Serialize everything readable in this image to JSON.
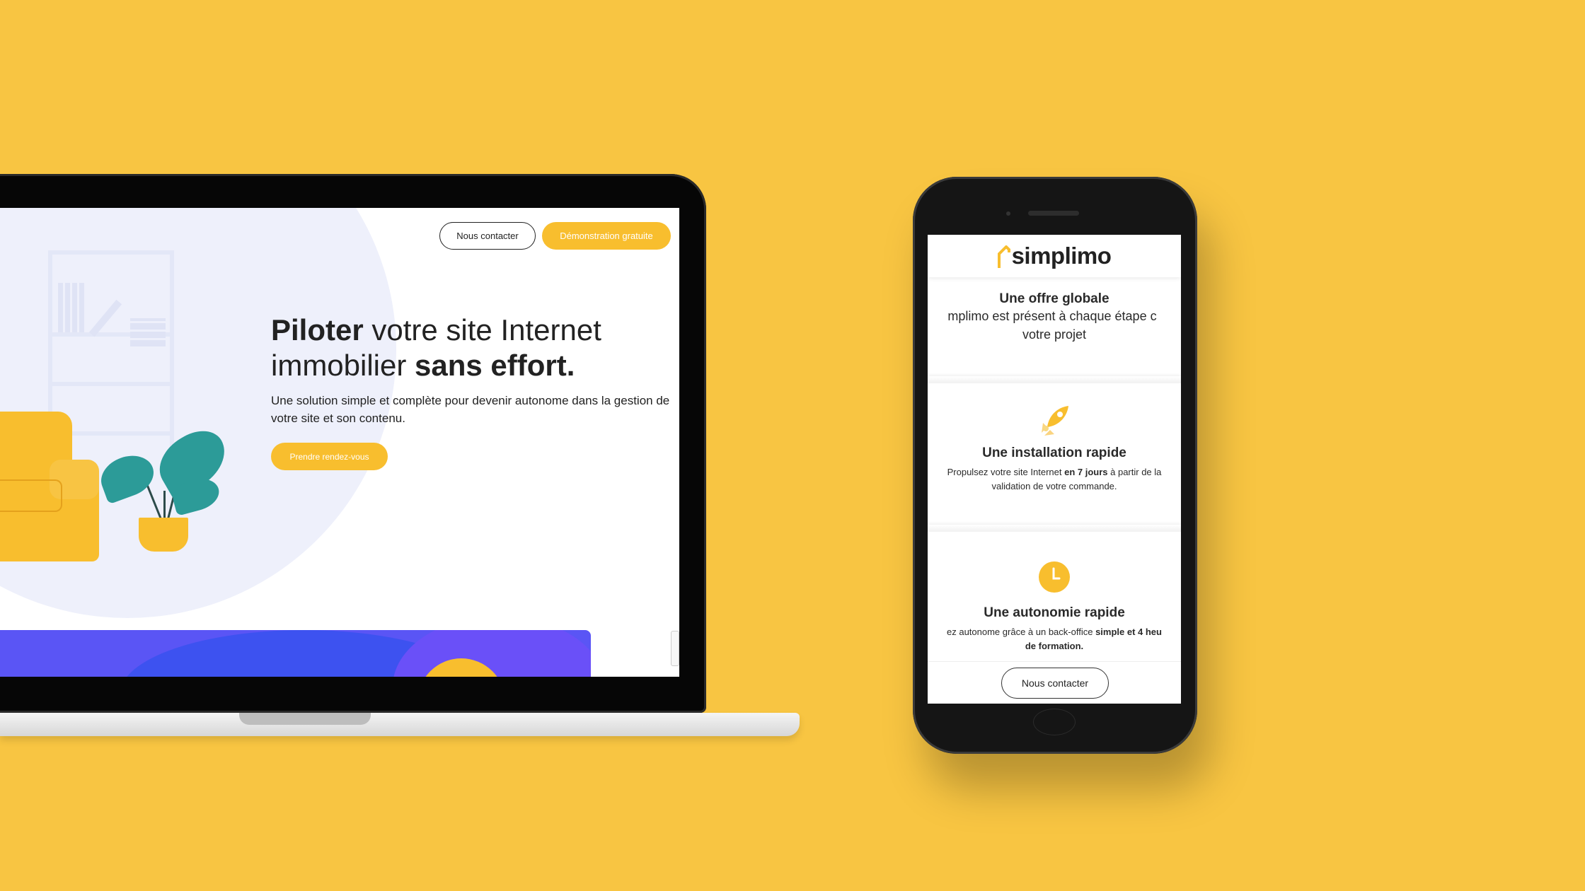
{
  "laptop": {
    "nav": {
      "contact_label": "Nous contacter",
      "demo_label": "Démonstration gratuite"
    },
    "hero": {
      "title_bold_1": "Piloter",
      "title_regular_1": " votre site Internet",
      "title_regular_2": "immobilier ",
      "title_bold_2": "sans effort.",
      "subtitle": "Une solution simple et complète pour devenir autonome dans la gestion de votre site et son contenu.",
      "cta_label": "Prendre rendez-vous"
    }
  },
  "phone": {
    "brand": "simplimo",
    "cards": [
      {
        "title": "Une offre globale",
        "text_line_1": "mplimo est présent à chaque étape c",
        "text_line_2": "votre projet"
      },
      {
        "icon": "rocket-icon",
        "title": "Une installation rapide",
        "text_prefix": "Propulsez votre site Internet ",
        "text_bold": "en 7 jours",
        "text_suffix": " à partir de la",
        "text_line_2": "validation de votre commande."
      },
      {
        "icon": "clock-icon",
        "title": "Une autonomie rapide",
        "text_prefix": "ez autonome grâce à un back-office ",
        "text_bold": "simple et 4 heu",
        "text_line_2": "de formation."
      }
    ],
    "footer_contact_label": "Nous contacter"
  },
  "colors": {
    "background": "#F8C542",
    "accent_yellow": "#F8BE2E",
    "leaf_teal": "#2C9B98",
    "band_purple": "#5A55F5"
  }
}
